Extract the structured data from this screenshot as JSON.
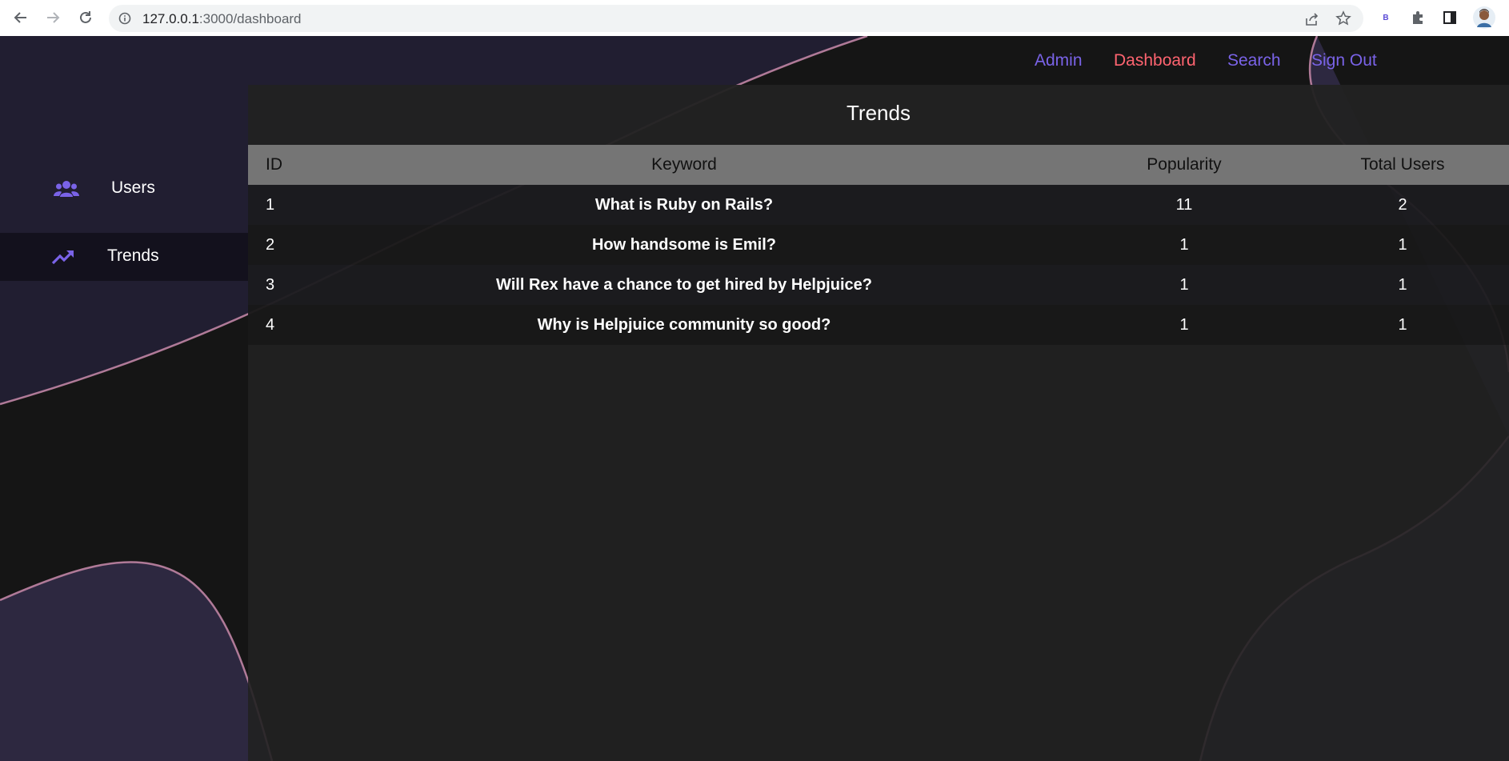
{
  "browser": {
    "url_host": "127.0.0.1",
    "url_path": ":3000/dashboard",
    "profile_badge": "B"
  },
  "nav": {
    "admin": "Admin",
    "dashboard": "Dashboard",
    "search": "Search",
    "sign_out": "Sign Out"
  },
  "sidebar": {
    "items": [
      {
        "label": "Users",
        "icon": "users-icon"
      },
      {
        "label": "Trends",
        "icon": "trending-up-icon",
        "active": true
      }
    ]
  },
  "main": {
    "title": "Trends",
    "columns": [
      "ID",
      "Keyword",
      "Popularity",
      "Total Users"
    ],
    "rows": [
      {
        "id": "1",
        "keyword": "What is Ruby on Rails?",
        "popularity": "11",
        "total_users": "2"
      },
      {
        "id": "2",
        "keyword": "How handsome is Emil?",
        "popularity": "1",
        "total_users": "1"
      },
      {
        "id": "3",
        "keyword": "Will Rex have a chance to get hired by Helpjuice?",
        "popularity": "1",
        "total_users": "1"
      },
      {
        "id": "4",
        "keyword": "Why is Helpjuice community so good?",
        "popularity": "1",
        "total_users": "1"
      }
    ]
  },
  "colors": {
    "nav_link": "#7a63e8",
    "nav_active": "#ff6470",
    "header_row": "#757575",
    "background_shape": "#2d2840",
    "shape_outline": "#b07a98"
  }
}
